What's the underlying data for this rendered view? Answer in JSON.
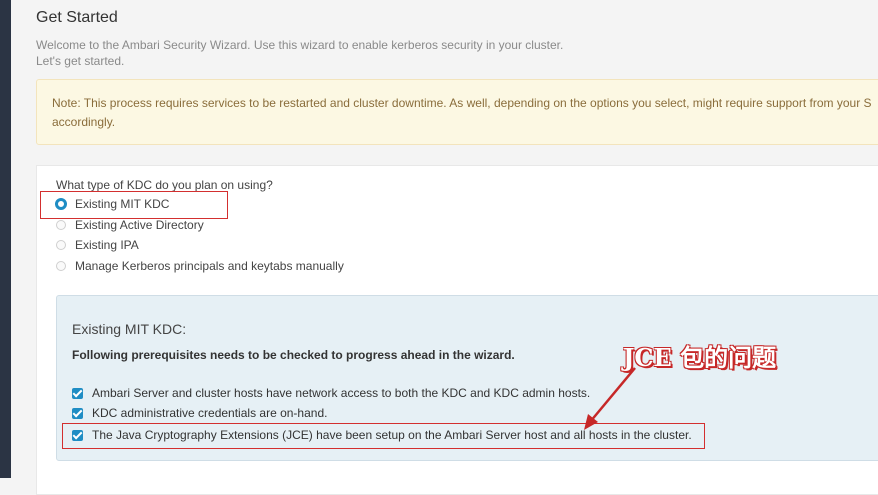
{
  "header": {
    "title": "Get Started",
    "intro_line1": "Welcome to the Ambari Security Wizard. Use this wizard to enable kerberos security in your cluster.",
    "intro_line2": "Let's get started."
  },
  "alert": {
    "line1": "Note: This process requires services to be restarted and cluster downtime. As well, depending on the options you select, might require support from your S",
    "line2": "accordingly."
  },
  "kdc": {
    "question": "What type of KDC do you plan on using?",
    "options": [
      {
        "label": "Existing MIT KDC",
        "selected": true
      },
      {
        "label": "Existing Active Directory",
        "selected": false
      },
      {
        "label": "Existing IPA",
        "selected": false
      },
      {
        "label": "Manage Kerberos principals and keytabs manually",
        "selected": false
      }
    ]
  },
  "prereq": {
    "title": "Existing MIT KDC:",
    "subtitle": "Following prerequisites needs to be checked to progress ahead in the wizard.",
    "items": [
      {
        "label": "Ambari Server and cluster hosts have network access to both the KDC and KDC admin hosts.",
        "checked": true
      },
      {
        "label": "KDC administrative credentials are on-hand.",
        "checked": true
      },
      {
        "label": "The Java Cryptography Extensions (JCE) have been setup on the Ambari Server host and all hosts in the cluster.",
        "checked": true
      }
    ]
  },
  "annotation": {
    "text": "JCE 包的问题",
    "color": "#c62828"
  },
  "colors": {
    "accent": "#1f8dc4",
    "alert_bg": "#fcf8e3",
    "panel_bg": "#e6f0f5",
    "sidebar": "#2b3444"
  }
}
